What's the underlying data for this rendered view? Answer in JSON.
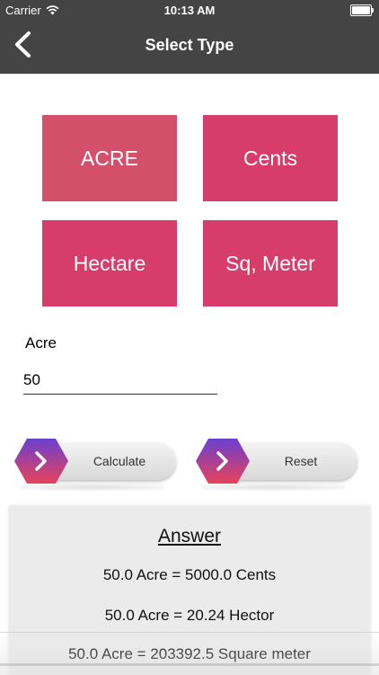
{
  "status_bar": {
    "carrier": "Carrier",
    "time": "10:13 AM",
    "icons": [
      "wifi-icon",
      "battery-icon"
    ]
  },
  "nav": {
    "title": "Select Type",
    "back_icon": "chevron-left-icon"
  },
  "types": [
    "ACRE",
    "Cents",
    "Hectare",
    "Sq, Meter"
  ],
  "input": {
    "label": "Acre",
    "value": "50"
  },
  "buttons": {
    "calculate": "Calculate",
    "reset": "Reset",
    "icon": "chevron-right-icon"
  },
  "answer": {
    "title": "Answer",
    "lines": [
      "50.0 Acre = 5000.0 Cents",
      "50.0 Acre = 20.24 Hector",
      "50.0 Acre = 203392.5 Square meter"
    ]
  },
  "colors": {
    "header": "#444444",
    "tile": "#d63d6a",
    "tile_acre": "#d4506a",
    "hex_top": "#6a3fd0",
    "hex_bottom": "#e8435a",
    "panel": "#ebebeb"
  }
}
